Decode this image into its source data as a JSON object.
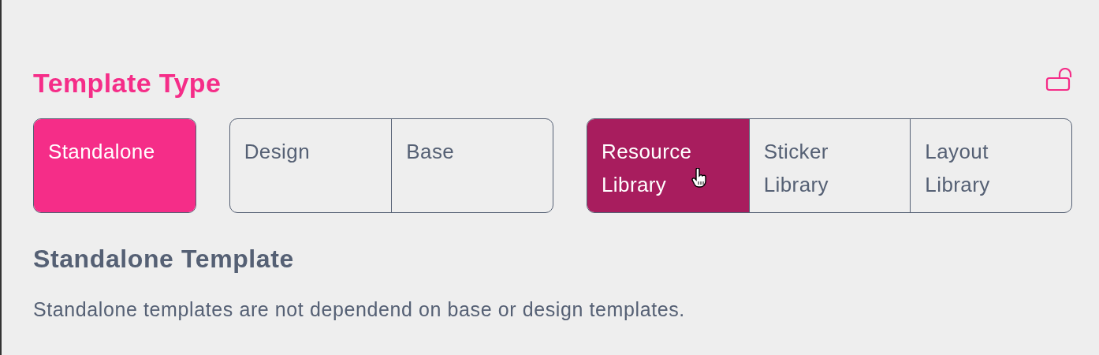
{
  "section_title": "Template Type",
  "lock": {
    "locked": false
  },
  "button_groups": [
    {
      "buttons": [
        {
          "label": "Standalone",
          "selected": true,
          "hovered": false
        }
      ]
    },
    {
      "buttons": [
        {
          "label": "Design",
          "selected": false,
          "hovered": false
        },
        {
          "label": "Base",
          "selected": false,
          "hovered": false
        }
      ]
    },
    {
      "buttons": [
        {
          "label": "Resource Library",
          "selected": false,
          "hovered": true
        },
        {
          "label": "Sticker Library",
          "selected": false,
          "hovered": false
        },
        {
          "label": "Layout Library",
          "selected": false,
          "hovered": false
        }
      ]
    }
  ],
  "heading": "Standalone Template",
  "description": "Standalone templates are not dependend on base or design templates."
}
